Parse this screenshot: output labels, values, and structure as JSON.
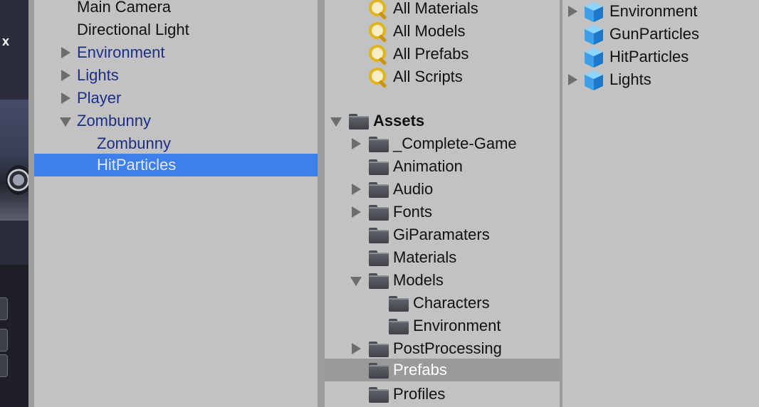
{
  "scene_view": {
    "close_glyph": "x"
  },
  "hierarchy": {
    "items": [
      {
        "label": "Main Camera",
        "style": "normal",
        "arrow": "none"
      },
      {
        "label": "Directional Light",
        "style": "normal",
        "arrow": "none"
      },
      {
        "label": "Environment",
        "style": "prefab",
        "arrow": "collapsed"
      },
      {
        "label": "Lights",
        "style": "prefab",
        "arrow": "collapsed"
      },
      {
        "label": "Player",
        "style": "prefab",
        "arrow": "collapsed"
      },
      {
        "label": "Zombunny",
        "style": "prefab",
        "arrow": "expanded"
      },
      {
        "label": "Zombunny",
        "style": "prefab",
        "arrow": "none"
      },
      {
        "label": "HitParticles",
        "style": "selected",
        "arrow": "none"
      }
    ]
  },
  "project": {
    "favorites": [
      {
        "label": "All Materials",
        "icon": "search-icon"
      },
      {
        "label": "All Models",
        "icon": "search-icon"
      },
      {
        "label": "All Prefabs",
        "icon": "search-icon"
      },
      {
        "label": "All Scripts",
        "icon": "search-icon"
      }
    ],
    "tree": [
      {
        "label": "Assets",
        "arrow": "expanded",
        "bold": true
      },
      {
        "label": "_Complete-Game",
        "arrow": "collapsed"
      },
      {
        "label": "Animation",
        "arrow": "none"
      },
      {
        "label": "Audio",
        "arrow": "collapsed"
      },
      {
        "label": "Fonts",
        "arrow": "collapsed"
      },
      {
        "label": "GiParamaters",
        "arrow": "none"
      },
      {
        "label": "Materials",
        "arrow": "none"
      },
      {
        "label": "Models",
        "arrow": "expanded"
      },
      {
        "label": "Characters",
        "arrow": "none"
      },
      {
        "label": "Environment",
        "arrow": "none"
      },
      {
        "label": "PostProcessing",
        "arrow": "collapsed"
      },
      {
        "label": "Prefabs",
        "arrow": "none",
        "selected": true
      },
      {
        "label": "Profiles",
        "arrow": "none"
      }
    ]
  },
  "assets": {
    "items": [
      {
        "label": "Environment",
        "arrow": "collapsed",
        "icon": "prefab-cube-icon"
      },
      {
        "label": "GunParticles",
        "arrow": "none",
        "icon": "prefab-cube-icon"
      },
      {
        "label": "HitParticles",
        "arrow": "none",
        "icon": "prefab-cube-icon"
      },
      {
        "label": "Lights",
        "arrow": "collapsed",
        "icon": "prefab-cube-icon"
      }
    ]
  },
  "colors": {
    "panel_bg": "#c2c2c2",
    "prefab_text": "#1b2f8a",
    "selection_blue": "#3e80ea",
    "folder_selection_gray": "#9a9a9a"
  }
}
